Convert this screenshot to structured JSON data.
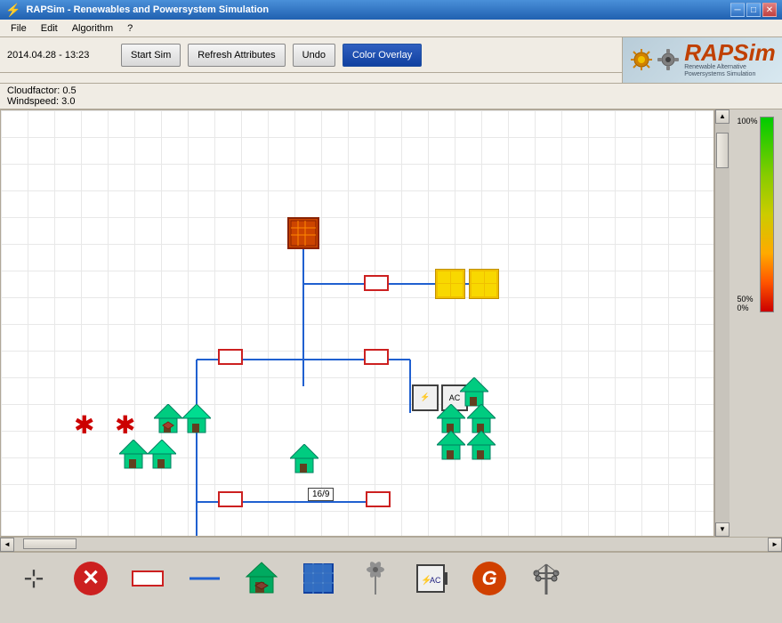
{
  "window": {
    "title": "RAPSim - Renewables and Powersystem Simulation",
    "icon": "⚡"
  },
  "titlebar": {
    "minimize": "─",
    "maximize": "□",
    "close": "✕"
  },
  "menu": {
    "items": [
      "File",
      "Edit",
      "Algorithm",
      "?"
    ]
  },
  "toolbar": {
    "datetime": "2014.04.28 - 13:23",
    "start_sim": "Start Sim",
    "refresh_attributes": "Refresh Attributes",
    "undo": "Undo",
    "color_overlay": "Color Overlay"
  },
  "info": {
    "cloudfactor": "Cloudfactor: 0.5",
    "windspeed": "Windspeed: 3.0"
  },
  "colorbar": {
    "top_label": "100%",
    "mid_label": "50%",
    "bot_label": "0%"
  },
  "logo": {
    "main": "RAPSim",
    "sub": "Renewable Alternative Powersystems Simulation"
  },
  "bottom_toolbar": {
    "items": [
      {
        "name": "move-tool",
        "icon": "⊹",
        "label": ""
      },
      {
        "name": "delete-tool",
        "icon": "✕",
        "label": ""
      },
      {
        "name": "wire-tool",
        "icon": "wire",
        "label": ""
      },
      {
        "name": "line-tool",
        "icon": "line",
        "label": ""
      },
      {
        "name": "house-tool",
        "icon": "house",
        "label": ""
      },
      {
        "name": "solar-tool",
        "icon": "solar",
        "label": ""
      },
      {
        "name": "wind-tool",
        "icon": "wind",
        "label": ""
      },
      {
        "name": "battery-tool",
        "icon": "battery",
        "label": ""
      },
      {
        "name": "generator-tool",
        "icon": "G",
        "label": ""
      },
      {
        "name": "pole-tool",
        "icon": "pole",
        "label": ""
      }
    ]
  },
  "canvas": {
    "label_16_9": "16/9"
  }
}
